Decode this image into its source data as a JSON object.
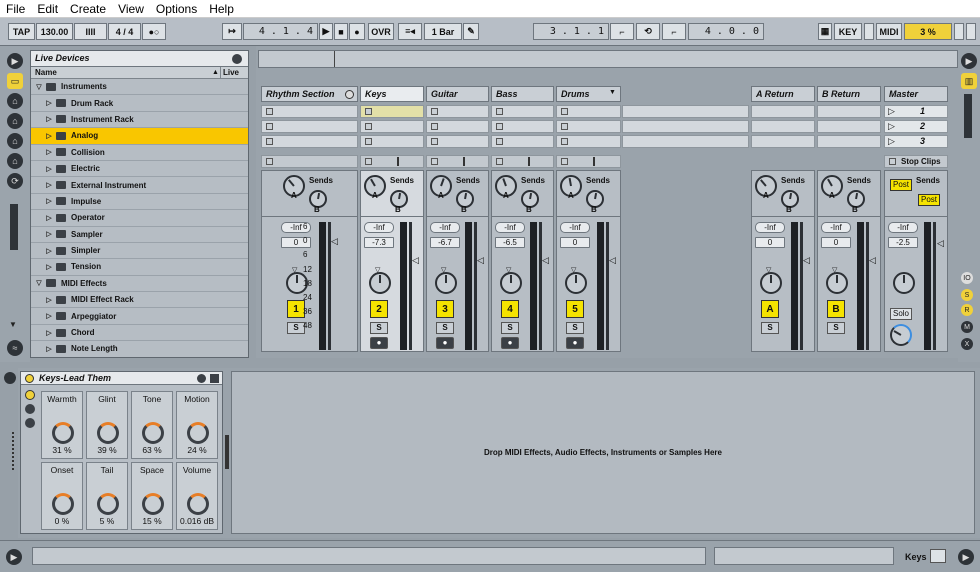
{
  "menu": [
    "File",
    "Edit",
    "Create",
    "View",
    "Options",
    "Help"
  ],
  "transport": {
    "tap": "TAP",
    "tempo": "130.00",
    "meter_icon": "IIII",
    "sig": "4 / 4",
    "oo": "●○",
    "follow": "↦",
    "position": "4 . 1 . 4",
    "play": "▶",
    "stop": "■",
    "rec": "●",
    "ovr": "OVR",
    "quant": "1 Bar",
    "loop_start": "3 . 1 . 1",
    "loop_len": "4 . 0 . 0",
    "key": "KEY",
    "midi": "MIDI",
    "cpu": "3 %"
  },
  "browser": {
    "title": "Live Devices",
    "col_name": "Name",
    "col_live": "Live Pa",
    "items": [
      {
        "label": "Instruments",
        "level": 0,
        "open": true
      },
      {
        "label": "Drum Rack",
        "level": 1
      },
      {
        "label": "Instrument Rack",
        "level": 1
      },
      {
        "label": "Analog",
        "level": 1,
        "selected": true
      },
      {
        "label": "Collision",
        "level": 1
      },
      {
        "label": "Electric",
        "level": 1
      },
      {
        "label": "External Instrument",
        "level": 1
      },
      {
        "label": "Impulse",
        "level": 1
      },
      {
        "label": "Operator",
        "level": 1
      },
      {
        "label": "Sampler",
        "level": 1
      },
      {
        "label": "Simpler",
        "level": 1
      },
      {
        "label": "Tension",
        "level": 1
      },
      {
        "label": "MIDI Effects",
        "level": 0,
        "open": true
      },
      {
        "label": "MIDI Effect Rack",
        "level": 1
      },
      {
        "label": "Arpeggiator",
        "level": 1
      },
      {
        "label": "Chord",
        "level": 1
      },
      {
        "label": "Note Length",
        "level": 1
      }
    ]
  },
  "tracks": [
    {
      "name": "Rhythm Section",
      "num": "",
      "vol": "0",
      "inf": "-Inf",
      "group": true
    },
    {
      "name": "Keys",
      "num": "2",
      "vol": "-7.3",
      "inf": "-Inf",
      "selected": true
    },
    {
      "name": "Guitar",
      "num": "3",
      "vol": "-6.7",
      "inf": "-Inf"
    },
    {
      "name": "Bass",
      "num": "4",
      "vol": "-6.5",
      "inf": "-Inf"
    },
    {
      "name": "Drums",
      "num": "5",
      "vol": "0",
      "inf": "-Inf"
    }
  ],
  "group_strip": {
    "num": "1",
    "scale": [
      "6",
      "0",
      "6",
      "12",
      "18",
      "24",
      "36",
      "48"
    ]
  },
  "returns": [
    {
      "name": "A Return",
      "num": "A",
      "vol": "0",
      "inf": "-Inf"
    },
    {
      "name": "B Return",
      "num": "B",
      "vol": "0",
      "inf": "-Inf"
    }
  ],
  "master": {
    "name": "Master",
    "scenes": [
      "1",
      "2",
      "3"
    ],
    "stop_clips": "Stop Clips",
    "vol": "-2.5",
    "inf": "-Inf",
    "solo": "Solo",
    "post": "Post"
  },
  "labels": {
    "sends": "Sends",
    "a": "A",
    "b": "B",
    "s": "S"
  },
  "device": {
    "title": "Keys-Lead Them",
    "macros": [
      {
        "name": "Warmth",
        "value": "31 %"
      },
      {
        "name": "Glint",
        "value": "39 %"
      },
      {
        "name": "Tone",
        "value": "63 %"
      },
      {
        "name": "Motion",
        "value": "24 %"
      },
      {
        "name": "Onset",
        "value": "0 %"
      },
      {
        "name": "Tail",
        "value": "5 %"
      },
      {
        "name": "Space",
        "value": "15 %"
      },
      {
        "name": "Volume",
        "value": "0.016 dB"
      }
    ]
  },
  "drop_text": "Drop MIDI Effects, Audio Effects, Instruments or Samples Here",
  "status": {
    "track": "Keys"
  },
  "colors": {
    "accent": "#f9c600",
    "track_num": "#f5e300",
    "orange": "#e87e26"
  }
}
